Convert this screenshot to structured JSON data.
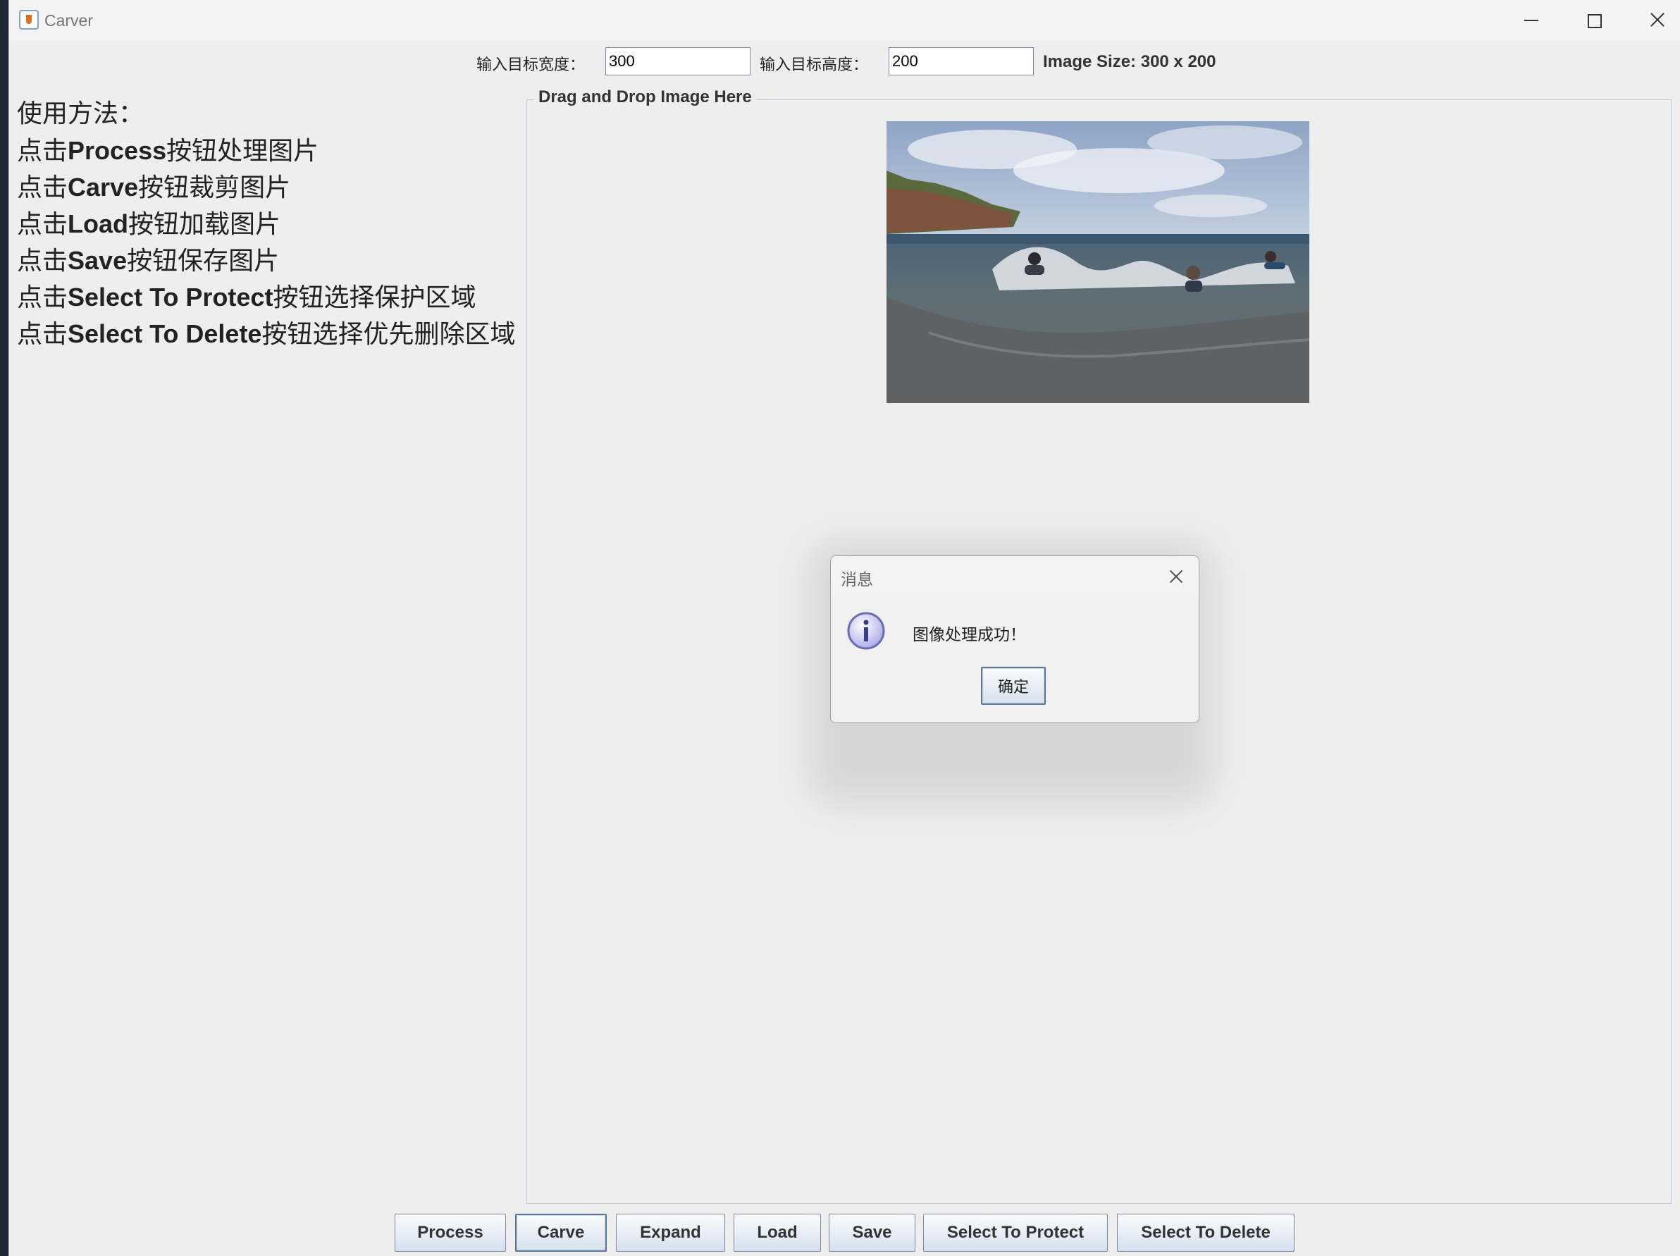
{
  "window": {
    "title": "Carver"
  },
  "topbar": {
    "width_label": "输入目标宽度：",
    "width_value": "300",
    "height_label": "输入目标高度：",
    "height_value": "200",
    "image_size": "Image Size: 300 x 200"
  },
  "instructions": {
    "heading": "使用方法：",
    "lines": [
      {
        "prefix": "点击",
        "keyword": "Process",
        "suffix": "按钮处理图片"
      },
      {
        "prefix": "点击",
        "keyword": "Carve",
        "suffix": "按钮裁剪图片"
      },
      {
        "prefix": "点击",
        "keyword": "Load",
        "suffix": "按钮加载图片"
      },
      {
        "prefix": "点击",
        "keyword": "Save",
        "suffix": "按钮保存图片"
      },
      {
        "prefix": "点击",
        "keyword": "Select To Protect",
        "suffix": "按钮选择保护区域"
      },
      {
        "prefix": "点击",
        "keyword": "Select To Delete",
        "suffix": "按钮选择优先删除区域"
      }
    ]
  },
  "drop_panel": {
    "title": "Drag and Drop Image Here"
  },
  "buttons": [
    "Process",
    "Carve",
    "Expand",
    "Load",
    "Save",
    "Select To Protect",
    "Select To Delete"
  ],
  "dialog": {
    "title": "消息",
    "message": "图像处理成功！",
    "ok_label": "确定"
  }
}
